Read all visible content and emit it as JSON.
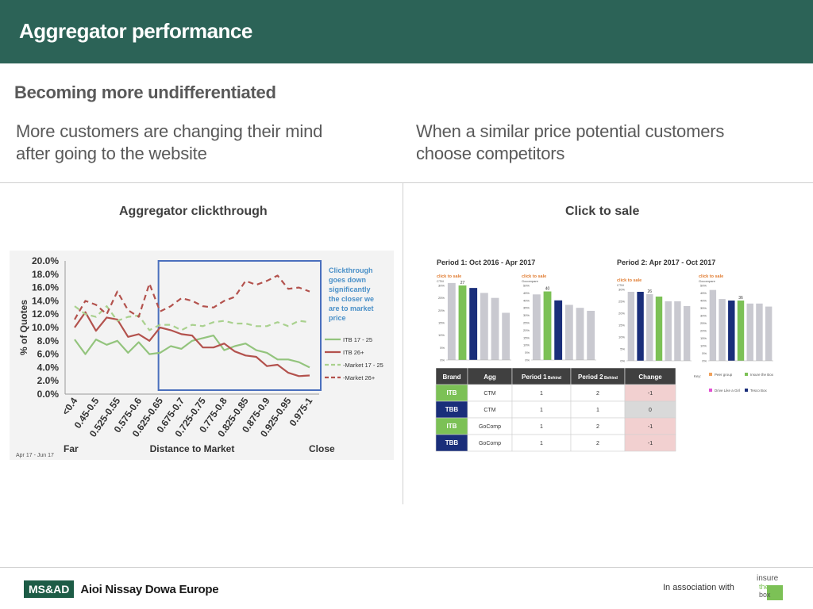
{
  "header": {
    "title": "Aggregator performance"
  },
  "subtitle": "Becoming more undifferentiated",
  "left_heading": [
    "More customers are changing their mind",
    "after going to the website"
  ],
  "right_heading": [
    "When a similar price potential customers",
    "choose competitors"
  ],
  "chart_titles": {
    "left": "Aggregator clickthrough",
    "right": "Click to sale"
  },
  "footer": {
    "brand_mark": "MS&AD",
    "brand_name": "Aioi Nissay Dowa Europe",
    "association": "In association with",
    "partner_logo_words": [
      "insure",
      "the",
      "box"
    ]
  },
  "chart_data": [
    {
      "type": "line",
      "ylabel": "% of Quotes",
      "xlabel": "Distance to Market",
      "x_far": "Far",
      "x_close": "Close",
      "date_note": "Apr 17 - Jun 17",
      "ylim": [
        0,
        20
      ],
      "yticks": [
        "20.0%",
        "18.0%",
        "16.0%",
        "14.0%",
        "12.0%",
        "10.0%",
        "8.0%",
        "6.0%",
        "4.0%",
        "2.0%",
        "0.0%"
      ],
      "categories": [
        "<0.4",
        "",
        "0.45-0.5",
        "",
        "0.525-0.55",
        "",
        "0.575-0.6",
        "",
        "0.625-0.65",
        "",
        "0.675-0.7",
        "",
        "0.725-0.75",
        "",
        "0.775-0.8",
        "",
        "0.825-0.85",
        "",
        "0.875-0.9",
        "",
        "0.925-0.95",
        "",
        "0.975-1"
      ],
      "annotation": [
        "Clickthrough",
        "goes down",
        "significantly",
        "the closer we",
        "are to market",
        "price"
      ],
      "series": [
        {
          "name": "ITB 17 - 25",
          "color": "#93c47d",
          "dash": "solid",
          "values": [
            8.2,
            6.0,
            8.2,
            7.4,
            8.0,
            6.2,
            7.8,
            6.0,
            6.2,
            7.2,
            6.8,
            8.0,
            8.4,
            8.8,
            6.6,
            7.2,
            7.6,
            6.6,
            6.2,
            5.2,
            5.2,
            4.8,
            4.0
          ]
        },
        {
          "name": "ITB 26+",
          "color": "#b3524d",
          "dash": "solid",
          "values": [
            10.0,
            12.3,
            9.5,
            11.5,
            11.2,
            8.6,
            9.0,
            8.0,
            10.0,
            9.6,
            9.0,
            8.8,
            7.0,
            7.0,
            7.6,
            6.4,
            5.8,
            5.6,
            4.2,
            4.4,
            3.2,
            2.7,
            2.8
          ]
        },
        {
          "name": "Market 17 - 25",
          "color": "#a9d18e",
          "dash": "dashed",
          "values": [
            13.2,
            12.0,
            11.6,
            13.2,
            11.0,
            11.6,
            11.8,
            9.6,
            10.4,
            10.4,
            9.6,
            10.4,
            10.2,
            10.8,
            11.0,
            10.6,
            10.6,
            10.2,
            10.2,
            10.8,
            10.2,
            11.0,
            10.8
          ]
        },
        {
          "name": "Market 26+",
          "color": "#b3524d",
          "dash": "dashed",
          "values": [
            11.2,
            14.0,
            13.4,
            12.0,
            15.4,
            12.6,
            11.6,
            16.6,
            12.4,
            13.2,
            14.4,
            14.0,
            13.2,
            13.0,
            14.0,
            14.6,
            17.0,
            16.4,
            17.0,
            17.8,
            15.8,
            16.0,
            15.4
          ]
        }
      ]
    },
    {
      "type": "bar",
      "title": "Period 1: Oct 2016 - Apr 2017",
      "panels": [
        {
          "label": "click to sale",
          "sub": "CTM",
          "yticks": [
            "30%",
            "25%",
            "20%",
            "15%",
            "10%",
            "5%",
            "0%"
          ],
          "ymax": 30,
          "values": [
            31,
            30,
            29,
            27,
            25,
            19
          ],
          "colors": [
            "#c9c9d0",
            "#7cc156",
            "#1a2e7a",
            "#c9c9d0",
            "#c9c9d0",
            "#c9c9d0"
          ],
          "label_value": "27",
          "label_index": 1
        },
        {
          "label": "click to sale",
          "sub": "Gocompare",
          "yticks": [
            "50%",
            "45%",
            "40%",
            "35%",
            "30%",
            "25%",
            "20%",
            "15%",
            "10%",
            "5%",
            "0%"
          ],
          "ymax": 50,
          "values": [
            44,
            46,
            40,
            37,
            35,
            33
          ],
          "colors": [
            "#c9c9d0",
            "#7cc156",
            "#1a2e7a",
            "#c9c9d0",
            "#c9c9d0",
            "#c9c9d0"
          ],
          "label_value": "40",
          "label_index": 1
        }
      ]
    },
    {
      "type": "bar",
      "title": "Period 2: Apr 2017 - Oct 2017",
      "panels": [
        {
          "label": "click to sale",
          "sub": "CTM",
          "yticks": [
            "30%",
            "25%",
            "20%",
            "15%",
            "10%",
            "5%",
            "0%"
          ],
          "ymax": 30,
          "values": [
            29,
            29,
            28,
            27,
            25,
            25,
            23
          ],
          "colors": [
            "#c9c9d0",
            "#1a2e7a",
            "#c9c9d0",
            "#7cc156",
            "#c9c9d0",
            "#c9c9d0",
            "#c9c9d0"
          ],
          "label_value": "26",
          "label_index": 2
        },
        {
          "label": "click to sale",
          "sub": "Gocompare",
          "yticks": [
            "50%",
            "45%",
            "40%",
            "35%",
            "30%",
            "25%",
            "20%",
            "15%",
            "10%",
            "5%",
            "0%"
          ],
          "ymax": 50,
          "values": [
            47,
            41,
            40,
            40,
            38,
            38,
            36
          ],
          "colors": [
            "#c9c9d0",
            "#c9c9d0",
            "#1a2e7a",
            "#7cc156",
            "#c9c9d0",
            "#c9c9d0",
            "#c9c9d0"
          ],
          "label_value": "36",
          "label_index": 3
        }
      ]
    },
    {
      "type": "table",
      "columns": [
        "Brand",
        "Agg",
        "Period 1",
        "Period 2",
        "Change"
      ],
      "column_suffix": [
        "",
        "",
        "Behind",
        "Behind",
        ""
      ],
      "rows": [
        {
          "brand": "ITB",
          "agg": "CTM",
          "p1": "1",
          "p2": "2",
          "change": "-1"
        },
        {
          "brand": "TBB",
          "agg": "CTM",
          "p1": "1",
          "p2": "1",
          "change": "0"
        },
        {
          "brand": "ITB",
          "agg": "GoComp",
          "p1": "1",
          "p2": "2",
          "change": "-1"
        },
        {
          "brand": "TBB",
          "agg": "GoComp",
          "p1": "1",
          "p2": "2",
          "change": "-1"
        }
      ],
      "legend": [
        {
          "label": "Peer group",
          "color": "#f0a15c"
        },
        {
          "label": "Insure the Box",
          "color": "#7cc156"
        },
        {
          "label": "Drive Like a Girl",
          "color": "#e24fd3"
        },
        {
          "label": "Tesco Box",
          "color": "#1a2e7a"
        }
      ],
      "legend_key": "Key:"
    }
  ]
}
